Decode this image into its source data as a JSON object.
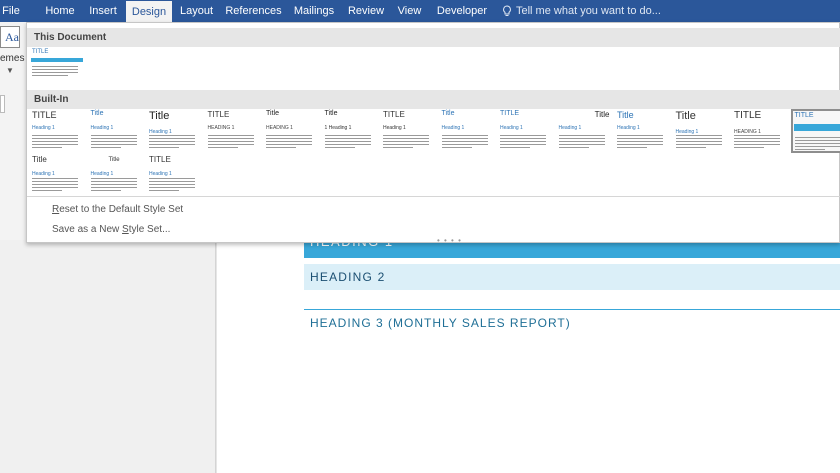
{
  "tabs": [
    {
      "label": "File",
      "active": false
    },
    {
      "label": "Home",
      "active": false
    },
    {
      "label": "Insert",
      "active": false
    },
    {
      "label": "Design",
      "active": true
    },
    {
      "label": "Layout",
      "active": false
    },
    {
      "label": "References",
      "active": false
    },
    {
      "label": "Mailings",
      "active": false
    },
    {
      "label": "Review",
      "active": false
    },
    {
      "label": "View",
      "active": false
    },
    {
      "label": "Developer",
      "active": false
    }
  ],
  "tell_me": {
    "text": "Tell me what you want to do...",
    "icon": "lightbulb-icon"
  },
  "themes": {
    "icon_text": "Aa",
    "label": "emes",
    "icon": "themes-icon"
  },
  "gallery": {
    "this_document": {
      "header": "This Document",
      "thumb": {
        "title": "TITLE"
      }
    },
    "built_in": {
      "header": "Built-In",
      "row1": [
        {
          "title": "TITLE",
          "heading": "Heading 1"
        },
        {
          "title": "Title",
          "heading": "Heading 1"
        },
        {
          "title": "Title",
          "heading": "Heading 1"
        },
        {
          "title": "TITLE",
          "heading": "HEADING 1"
        },
        {
          "title": "Title",
          "heading": "HEADING 1"
        },
        {
          "title": "Title",
          "heading": "1  Heading 1"
        },
        {
          "title": "TITLE",
          "heading": "Heading 1"
        },
        {
          "title": "Title",
          "heading": "Heading 1"
        },
        {
          "title": "TITLE",
          "heading": "Heading 1"
        },
        {
          "title": "Title",
          "heading": "Heading 1"
        },
        {
          "title": "Title",
          "heading": "Heading 1"
        },
        {
          "title": "Title",
          "heading": "Heading 1"
        },
        {
          "title": "TITLE",
          "heading": "HEADING 1"
        },
        {
          "title": "TITLE",
          "heading": ""
        }
      ],
      "row2": [
        {
          "title": "Title",
          "heading": "Heading 1"
        },
        {
          "title": "Title",
          "heading": "Heading 1"
        },
        {
          "title": "TITLE",
          "heading": "Heading 1"
        }
      ]
    },
    "menu": {
      "reset": {
        "prefix": "",
        "underlined": "R",
        "rest": "eset to the Default Style Set"
      },
      "save": {
        "prefix": "Save as a New ",
        "underlined": "S",
        "rest": "tyle Set..."
      }
    }
  },
  "document": {
    "heading1": "HEADING 1",
    "heading2": "HEADING 2",
    "heading3": "HEADING 3 (MONTHLY SALES REPORT)"
  },
  "colors": {
    "ribbon": "#2b579a",
    "accent": "#38a7d9",
    "heading2_fill": "#dbeff8"
  }
}
